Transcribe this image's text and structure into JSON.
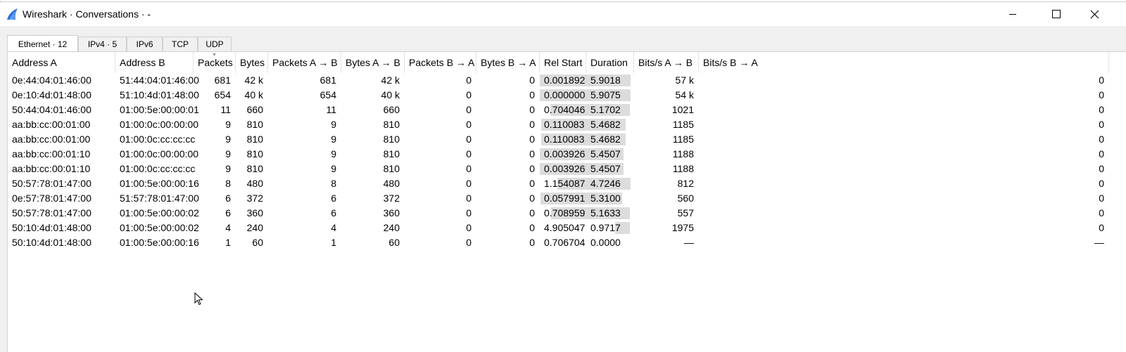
{
  "window": {
    "title": "Wireshark · Conversations · -",
    "minimize_icon": "minimize-icon",
    "maximize_icon": "maximize-icon",
    "close_icon": "close-icon"
  },
  "tabs": [
    {
      "label": "Ethernet · 12",
      "active": true
    },
    {
      "label": "IPv4 · 5",
      "active": false
    },
    {
      "label": "IPv6",
      "active": false
    },
    {
      "label": "TCP",
      "active": false
    },
    {
      "label": "UDP",
      "active": false
    }
  ],
  "table": {
    "columns": [
      "Address A",
      "Address B",
      "Packets",
      "Bytes",
      "Packets A → B",
      "Bytes A → B",
      "Packets B → A",
      "Bytes B → A",
      "Rel Start",
      "Duration",
      "Bits/s A → B",
      "Bits/s B → A"
    ],
    "sorted_column": "Packets",
    "total_duration": 6.1285,
    "rows": [
      [
        "0e:44:04:01:46:00",
        "51:44:04:01:46:00",
        "681",
        "42 k",
        "681",
        "42 k",
        "0",
        "0",
        "0.001892",
        "5.9018",
        "57 k",
        "0"
      ],
      [
        "0e:10:4d:01:48:00",
        "51:10:4d:01:48:00",
        "654",
        "40 k",
        "654",
        "40 k",
        "0",
        "0",
        "0.000000",
        "5.9075",
        "54 k",
        "0"
      ],
      [
        "50:44:04:01:46:00",
        "01:00:5e:00:00:01",
        "11",
        "660",
        "11",
        "660",
        "0",
        "0",
        "0.704046",
        "5.1702",
        "1021",
        "0"
      ],
      [
        "aa:bb:cc:00:01:00",
        "01:00:0c:00:00:00",
        "9",
        "810",
        "9",
        "810",
        "0",
        "0",
        "0.110083",
        "5.4682",
        "1185",
        "0"
      ],
      [
        "aa:bb:cc:00:01:00",
        "01:00:0c:cc:cc:cc",
        "9",
        "810",
        "9",
        "810",
        "0",
        "0",
        "0.110083",
        "5.4682",
        "1185",
        "0"
      ],
      [
        "aa:bb:cc:00:01:10",
        "01:00:0c:00:00:00",
        "9",
        "810",
        "9",
        "810",
        "0",
        "0",
        "0.003926",
        "5.4507",
        "1188",
        "0"
      ],
      [
        "aa:bb:cc:00:01:10",
        "01:00:0c:cc:cc:cc",
        "9",
        "810",
        "9",
        "810",
        "0",
        "0",
        "0.003926",
        "5.4507",
        "1188",
        "0"
      ],
      [
        "50:57:78:01:47:00",
        "01:00:5e:00:00:16",
        "8",
        "480",
        "8",
        "480",
        "0",
        "0",
        "1.154087",
        "4.7246",
        "812",
        "0"
      ],
      [
        "0e:57:78:01:47:00",
        "51:57:78:01:47:00",
        "6",
        "372",
        "6",
        "372",
        "0",
        "0",
        "0.057991",
        "5.3100",
        "560",
        "0"
      ],
      [
        "50:57:78:01:47:00",
        "01:00:5e:00:00:02",
        "6",
        "360",
        "6",
        "360",
        "0",
        "0",
        "0.708959",
        "5.1633",
        "557",
        "0"
      ],
      [
        "50:10:4d:01:48:00",
        "01:00:5e:00:00:02",
        "4",
        "240",
        "4",
        "240",
        "0",
        "0",
        "4.905047",
        "0.9717",
        "1975",
        "0"
      ],
      [
        "50:10:4d:01:48:00",
        "01:00:5e:00:00:16",
        "1",
        "60",
        "1",
        "60",
        "0",
        "0",
        "0.706704",
        "0.0000",
        "—",
        "—"
      ]
    ]
  },
  "colors": {
    "accent_icon": "#2a6ed8",
    "timeline_bar": "#dcdcdc"
  }
}
